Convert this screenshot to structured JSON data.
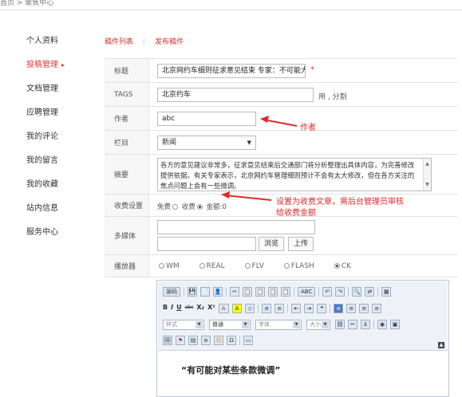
{
  "breadcrumb": "首页 > 聚焦中心",
  "sidebar": {
    "items": [
      {
        "label": "个人资料",
        "active": false
      },
      {
        "label": "投稿管理",
        "active": true,
        "caret": "▸"
      },
      {
        "label": "文档管理",
        "active": false
      },
      {
        "label": "应聘管理",
        "active": false
      },
      {
        "label": "我的评论",
        "active": false
      },
      {
        "label": "我的留言",
        "active": false
      },
      {
        "label": "我的收藏",
        "active": false
      },
      {
        "label": "站内信息",
        "active": false
      },
      {
        "label": "服务中心",
        "active": false
      }
    ]
  },
  "tabs": {
    "list": "稿件列表",
    "sep": "|",
    "publish": "发布稿件"
  },
  "form": {
    "title": {
      "label": "标题",
      "value": "北京网约车细则征求意见结束 专家：不可能大改",
      "required": "*"
    },
    "tags": {
      "label": "TAGS",
      "value": "北京约车",
      "hint": "用 , 分割"
    },
    "author": {
      "label": "作者",
      "value": "abc"
    },
    "column": {
      "label": "栏目",
      "value": "新闻",
      "arrow": "▼"
    },
    "summary": {
      "label": "摘要",
      "value": "各方的意见建议非常多，征求意见结束后交通部门将分析整理出具体内容，为完善修改提供依据。有关专家表示，北京网约车管理细则预计不会有太大修改，但在各方关注的焦点问题上会有一些微调。"
    },
    "charge": {
      "label": "收费设置",
      "free": "免费",
      "paid": "收费",
      "amount_label": "金额:",
      "amount_value": "0"
    },
    "media": {
      "label": "多媒体",
      "browse": "浏览",
      "upload": "上传"
    },
    "player": {
      "label": "播放器",
      "options": [
        "WM",
        "REAL",
        "FLV",
        "FLASH",
        "CK"
      ],
      "selected": "CK"
    }
  },
  "editor": {
    "toolbar": {
      "row1": [
        "源码",
        "💾",
        "📄",
        "👤",
        "✂",
        "📋",
        "📋",
        "📋",
        "📋",
        "ABC",
        "↶",
        "↷",
        "🔍",
        "⇄",
        "▦"
      ],
      "row2": [
        "B",
        "I",
        "U",
        "abc",
        "X₂",
        "X²",
        "A",
        "A",
        "◇",
        "≡",
        "≡",
        "⇤",
        "⇥",
        "❝",
        "≡",
        "≡",
        "≡",
        "≡"
      ],
      "format_sel": "样式",
      "para_sel": "普通",
      "font_sel": "字体",
      "size_sel": "大小",
      "row3_icons": [
        "🖼",
        "⚑",
        "▤",
        "≡",
        "☺",
        "Ω",
        "▭"
      ]
    },
    "content": "“有可能对某些条款微调”"
  },
  "annotations": {
    "author_note": "作者",
    "charge_note_line1": "设置为收费文章，需后台管理员审核",
    "charge_note_line2": "给收费金额"
  },
  "colors": {
    "accent": "#e03a3a",
    "annotation": "#e02a2a"
  }
}
